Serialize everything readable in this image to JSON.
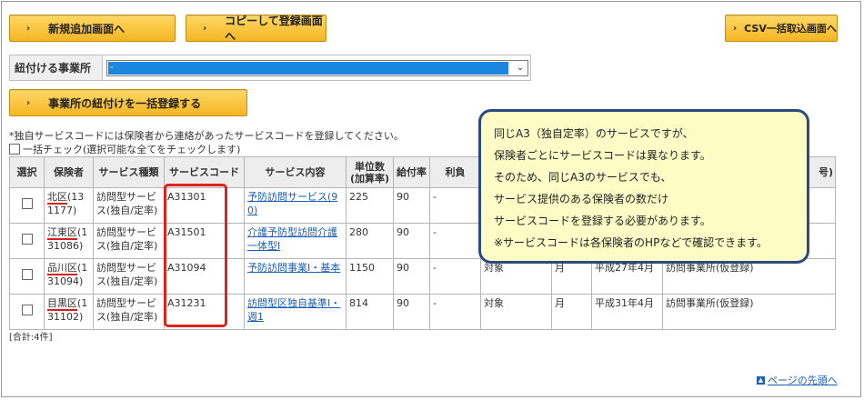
{
  "buttons": {
    "new": "新規追加画面へ",
    "copy": "コピーして登録画面へ",
    "csv": "CSV一括取込画面へ",
    "bulk": "事業所の紐付けを一括登録する"
  },
  "office": {
    "label": "紐付ける事業所",
    "selected": "-"
  },
  "note": "*独自サービスコードには保険者から連絡があったサービスコードを登録してください。",
  "bulk_check": "一括チェック(選択可能な全てをチェックします)",
  "table": {
    "headers": {
      "select": "選択",
      "insurer": "保険者",
      "service_type": "サービス種類",
      "service_code": "サービスコード",
      "service_content": "サービス内容",
      "unit": "単位数(加算率)",
      "rate": "給付率",
      "partial": "利負",
      "last": "号)"
    },
    "rows": [
      {
        "insurer": "北区",
        "insurer_code": "(131177)",
        "service_type": "訪問型サービス(独自/定率)",
        "code": "A31301",
        "content": "予防訪問サービス(90)",
        "unit": "225",
        "rate": "90",
        "c8": "-",
        "c9": "",
        "c10": "",
        "c11": "",
        "c12": ""
      },
      {
        "insurer": "江東区",
        "insurer_code": "(131086)",
        "service_type": "訪問型サービス(独自/定率)",
        "code": "A31501",
        "content": "介護予防型訪問介護一体型Ⅰ",
        "unit": "280",
        "rate": "90",
        "c8": "-",
        "c9": "",
        "c10": "",
        "c11": "",
        "c12": ""
      },
      {
        "insurer": "品川区",
        "insurer_code": "(131094)",
        "service_type": "訪問型サービス(独自/定率)",
        "code": "A31094",
        "content": "予防訪問事業Ⅰ・基本",
        "unit": "1150",
        "rate": "90",
        "c8": "-",
        "c9": "対象",
        "c10": "月",
        "c11": "平成27年4月",
        "c12": "訪問事業所(仮登録)"
      },
      {
        "insurer": "目黒区",
        "insurer_code": "(131102)",
        "service_type": "訪問型サービス(独自/定率)",
        "code": "A31231",
        "content": "訪問型区独自基準Ⅰ・週1",
        "unit": "814",
        "rate": "90",
        "c8": "-",
        "c9": "対象",
        "c10": "月",
        "c11": "平成31年4月",
        "c12": "訪問事業所(仮登録)"
      }
    ]
  },
  "count": "[合計:4件]",
  "callout": {
    "lines": [
      "同じA3（独自定率）のサービスですが、",
      "保険者ごとにサービスコードは異なります。",
      "そのため、同じA3のサービスでも、",
      "サービス提供のある保険者の数だけ",
      "サービスコードを登録する必要があります。",
      "※サービスコードは各保険者のHPなどで確認できます。"
    ]
  },
  "page_top": "ページの先頭へ",
  "colors": {
    "button": "#f5b523",
    "highlight": "#e0231a",
    "callout_bg": "#fdfcc6",
    "callout_border": "#2b4a7d",
    "link": "#1a5fb4"
  }
}
